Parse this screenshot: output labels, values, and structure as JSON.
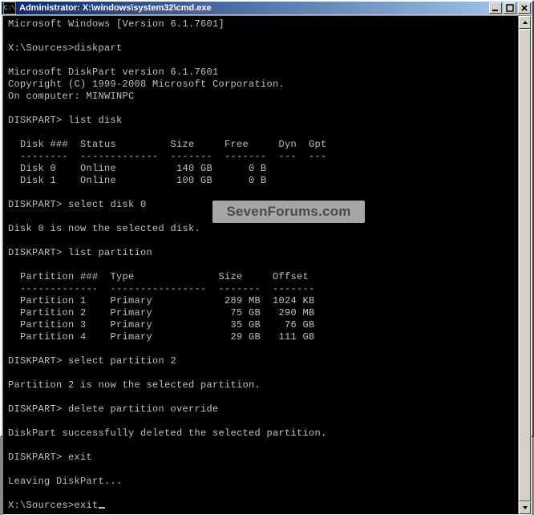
{
  "window": {
    "icon_label": "C:\\",
    "title": "Administrator: X:\\windows\\system32\\cmd.exe"
  },
  "lines": {
    "l0": "Microsoft Windows [Version 6.1.7601]",
    "l1": "",
    "l2": "X:\\Sources>diskpart",
    "l3": "",
    "l4": "Microsoft DiskPart version 6.1.7601",
    "l5": "Copyright (C) 1999-2008 Microsoft Corporation.",
    "l6": "On computer: MINWINPC",
    "l7": "",
    "l8": "DISKPART> list disk",
    "l9": "",
    "l10": "  Disk ###  Status         Size     Free     Dyn  Gpt",
    "l11": "  --------  -------------  -------  -------  ---  ---",
    "l12": "  Disk 0    Online          140 GB      0 B",
    "l13": "  Disk 1    Online          100 GB      0 B",
    "l14": "",
    "l15": "DISKPART> select disk 0",
    "l16": "",
    "l17": "Disk 0 is now the selected disk.",
    "l18": "",
    "l19": "DISKPART> list partition",
    "l20": "",
    "l21": "  Partition ###  Type              Size     Offset",
    "l22": "  -------------  ----------------  -------  -------",
    "l23": "  Partition 1    Primary            289 MB  1024 KB",
    "l24": "  Partition 2    Primary             75 GB   290 MB",
    "l25": "  Partition 3    Primary             35 GB    76 GB",
    "l26": "  Partition 4    Primary             29 GB   111 GB",
    "l27": "",
    "l28": "DISKPART> select partition 2",
    "l29": "",
    "l30": "Partition 2 is now the selected partition.",
    "l31": "",
    "l32": "DISKPART> delete partition override",
    "l33": "",
    "l34": "DiskPart successfully deleted the selected partition.",
    "l35": "",
    "l36": "DISKPART> exit",
    "l37": "",
    "l38": "Leaving DiskPart...",
    "l39": "",
    "l40": "X:\\Sources>exit"
  },
  "watermark": "SevenForums.com",
  "chart_data": {
    "disks": [
      {
        "id": "Disk 0",
        "status": "Online",
        "size": "140 GB",
        "free": "0 B",
        "dyn": "",
        "gpt": ""
      },
      {
        "id": "Disk 1",
        "status": "Online",
        "size": "100 GB",
        "free": "0 B",
        "dyn": "",
        "gpt": ""
      }
    ],
    "partitions": [
      {
        "id": "Partition 1",
        "type": "Primary",
        "size": "289 MB",
        "offset": "1024 KB"
      },
      {
        "id": "Partition 2",
        "type": "Primary",
        "size": "75 GB",
        "offset": "290 MB"
      },
      {
        "id": "Partition 3",
        "type": "Primary",
        "size": "35 GB",
        "offset": "76 GB"
      },
      {
        "id": "Partition 4",
        "type": "Primary",
        "size": "29 GB",
        "offset": "111 GB"
      }
    ],
    "commands": [
      "diskpart",
      "list disk",
      "select disk 0",
      "list partition",
      "select partition 2",
      "delete partition override",
      "exit",
      "exit"
    ]
  }
}
